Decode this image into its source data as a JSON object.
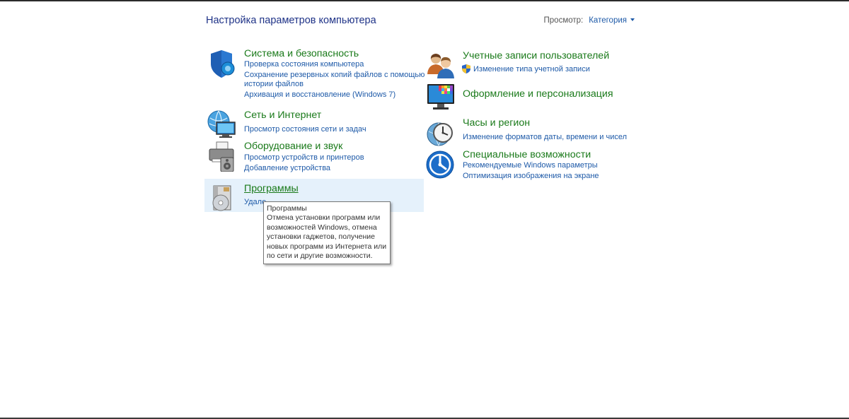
{
  "page": {
    "title": "Настройка параметров компьютера",
    "view_label": "Просмотр:",
    "view_value": "Категория"
  },
  "categories": [
    {
      "title": "Система и безопасность",
      "icon": "shield-icon",
      "links": [
        "Проверка состояния компьютера",
        "Сохранение резервных копий файлов с помощью",
        "истории файлов",
        "Архивация и восстановление (Windows 7)"
      ]
    },
    {
      "title": "Сеть и Интернет",
      "icon": "network-globe-icon",
      "links": [
        "Просмотр состояния сети и задач"
      ]
    },
    {
      "title": "Оборудование и звук",
      "icon": "printer-speaker-icon",
      "links": [
        "Просмотр устройств и принтеров",
        "Добавление устройства"
      ]
    },
    {
      "title": "Программы",
      "icon": "programs-disc-icon",
      "links": [
        "Удале"
      ]
    },
    {
      "title": "Учетные записи пользователей",
      "icon": "users-icon",
      "links": [
        "Изменение типа учетной записи"
      ]
    },
    {
      "title": "Оформление и персонализация",
      "icon": "monitor-palette-icon",
      "links": []
    },
    {
      "title": "Часы и регион",
      "icon": "clock-globe-icon",
      "links": [
        "Изменение форматов даты, времени и чисел"
      ]
    },
    {
      "title": "Специальные возможности",
      "icon": "accessibility-icon",
      "links": [
        "Рекомендуемые Windows параметры",
        "Оптимизация изображения на экране"
      ]
    }
  ],
  "tooltip": {
    "lines": [
      "Программы",
      "Отмена установки программ или",
      "возможностей Windows, отмена",
      "установки гаджетов, получение",
      "новых программ из Интернета или",
      "по сети и другие возможности."
    ]
  },
  "colors": {
    "category_title": "#1a7a1a",
    "link": "#1e5aa8",
    "title": "#1e3287",
    "hover_highlight": "#e5f1fb"
  }
}
